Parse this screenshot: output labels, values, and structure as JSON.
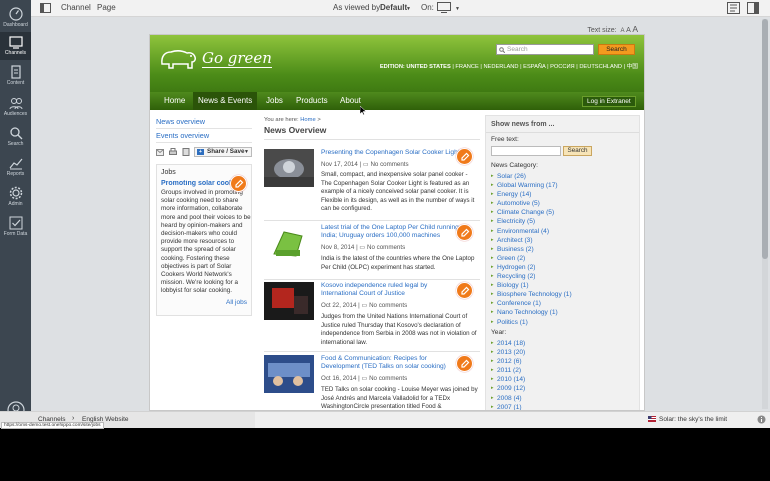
{
  "rail": {
    "items": [
      {
        "label": "Dashboard",
        "icon": "dashboard-icon"
      },
      {
        "label": "Channels",
        "icon": "channels-icon"
      },
      {
        "label": "Content",
        "icon": "content-icon"
      },
      {
        "label": "Audiences",
        "icon": "audiences-icon"
      },
      {
        "label": "Search",
        "icon": "search-icon"
      },
      {
        "label": "Reports",
        "icon": "reports-icon"
      },
      {
        "label": "Admin",
        "icon": "admin-icon"
      },
      {
        "label": "Form Data",
        "icon": "form-data-icon"
      }
    ]
  },
  "topbar": {
    "channel": "Channel",
    "page": "Page",
    "viewed_by_label": "As viewed by:",
    "viewed_by_value": "Default",
    "on_label": "On:"
  },
  "textsize": {
    "label": "Text size:",
    "a1": "A",
    "a2": "A",
    "a3": "A"
  },
  "site": {
    "logo_text": "Go green",
    "search_placeholder": "Search",
    "search_button": "Search",
    "edition_label": "EDITION:",
    "editions": [
      "UNITED STATES",
      "FRANCE",
      "NEDERLAND",
      "ESPAÑA",
      "РОССИЯ",
      "DEUTSCHLAND",
      "中国"
    ],
    "nav": [
      "Home",
      "News & Events",
      "Jobs",
      "Products",
      "About"
    ],
    "login": "Log in Extranet",
    "left": {
      "news_overview": "News overview",
      "events_overview": "Events overview",
      "share_save": "Share / Save",
      "jobs_title": "Jobs",
      "job_title": "Promoting solar cooking",
      "job_body": "Groups involved in promoting solar cooking need to share more information, collaborate more and pool their voices to be heard by opinion-makers and decision-makers who could provide more resources to support the spread of solar cooking. Fostering these objectives is part of Solar Cookers World Network's mission. We're looking for a lobbyist for solar cooking.",
      "all_jobs": "All jobs"
    },
    "breadcrumb_label": "You are here:",
    "breadcrumb_home": "Home",
    "breadcrumb_sep": ">",
    "center_title": "News Overview",
    "news": [
      {
        "title": "Presenting the Copenhagen Solar Cooker Light",
        "date": "Nov 17, 2014",
        "comments": "No comments",
        "body": "Small, compact, and inexpensive solar panel cooker - The Copenhagen Solar Cooker Light is featured as an example of a nicely conceived solar panel cooker. It is Flexible in its design, as well as in the number of ways it can be configured."
      },
      {
        "title": "Latest trial of the One Laptop Per Child running India; Uruguay orders 100,000 machines",
        "date": "Nov 8, 2014",
        "comments": "No comments",
        "body": "India is the latest of the countries where the One Laptop Per Child (OLPC) experiment has started."
      },
      {
        "title": "Kosovo independence ruled legal by International Court of Justice",
        "date": "Oct 22, 2014",
        "comments": "No comments",
        "body": "Judges from the United Nations International Court of Justice ruled Thursday that Kosovo's declaration of independence from Serbia in 2008 was not in violation of international law."
      },
      {
        "title": "Food & Communication: Recipes for Development (TED Talks on solar cooking)",
        "date": "Oct 16, 2014",
        "comments": "No comments",
        "body": "TED Talks on solar cooking - Louise Meyer was joined by José Andrés and Marcela Valladolid for a TEDx WashingtonCircle presentation titled Food & Communication: Recipes for Development."
      }
    ],
    "right": {
      "title": "Show news from ...",
      "free_text": "Free text:",
      "search_button": "Search",
      "category_label": "News Category:",
      "categories": [
        "Solar (26)",
        "Global Warming (17)",
        "Energy (14)",
        "Automotive (5)",
        "Climate Change (5)",
        "Electricity (5)",
        "Environmental (4)",
        "Architect (3)",
        "Business (2)",
        "Green (2)",
        "Hydrogen (2)",
        "Recycling (2)",
        "Biology (1)",
        "Biosphere Technology (1)",
        "Conference (1)",
        "Nano Technology (1)",
        "Politics (1)"
      ],
      "year_label": "Year:",
      "years": [
        "2014 (18)",
        "2013 (20)",
        "2012 (6)",
        "2011 (2)",
        "2010 (14)",
        "2009 (12)",
        "2008 (4)",
        "2007 (1)"
      ]
    }
  },
  "status": {
    "tab1": "Channels",
    "tab2": "English Website",
    "url": "https://oms-demo.test.onehippo.com/site/jobs",
    "right": "Solar: the sky's the limit"
  }
}
